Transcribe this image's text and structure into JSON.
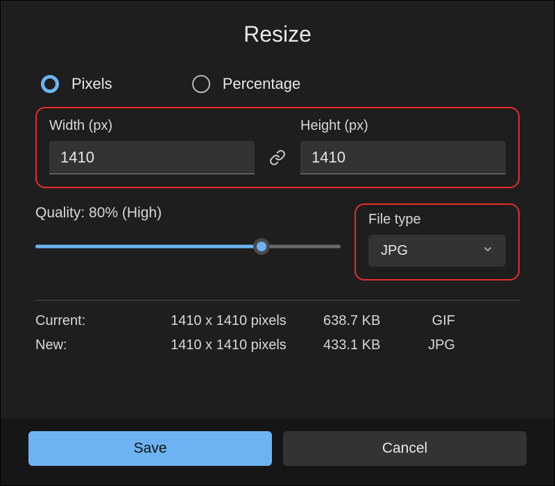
{
  "title": "Resize",
  "radios": {
    "pixels": "Pixels",
    "percentage": "Percentage",
    "selected": "pixels"
  },
  "dimensions": {
    "width_label": "Width  (px)",
    "height_label": "Height  (px)",
    "width_value": "1410",
    "height_value": "1410",
    "link_icon": "link-icon"
  },
  "quality": {
    "label": "Quality: 80% (High)",
    "percent": 74
  },
  "filetype": {
    "label": "File type",
    "value": "JPG"
  },
  "info": {
    "current_label": "Current:",
    "current_dims": "1410 x 1410 pixels",
    "current_size": "638.7 KB",
    "current_fmt": "GIF",
    "new_label": "New:",
    "new_dims": "1410 x 1410 pixels",
    "new_size": "433.1 KB",
    "new_fmt": "JPG"
  },
  "buttons": {
    "save": "Save",
    "cancel": "Cancel"
  },
  "colors": {
    "accent": "#6db3f2",
    "highlight": "#e82c2c"
  }
}
